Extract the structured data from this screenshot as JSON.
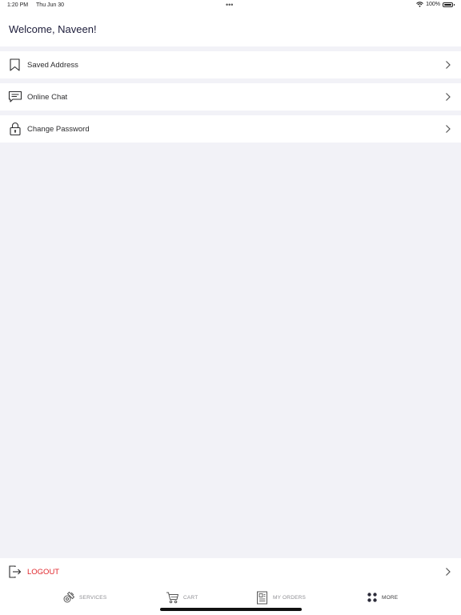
{
  "status": {
    "time": "1:20 PM",
    "date": "Thu Jun 30",
    "battery": "100%"
  },
  "header": {
    "title": "Welcome, Naveen!"
  },
  "menu": [
    {
      "label": "Saved Address",
      "icon": "bookmark-icon"
    },
    {
      "label": "Online Chat",
      "icon": "chat-icon"
    },
    {
      "label": "Change Password",
      "icon": "lock-icon"
    }
  ],
  "logout": {
    "label": "LOGOUT",
    "icon": "logout-icon",
    "color": "#e0262b"
  },
  "tabs": [
    {
      "label": "SERVICES",
      "icon": "services-icon"
    },
    {
      "label": "CART",
      "icon": "cart-icon"
    },
    {
      "label": "MY ORDERS",
      "icon": "orders-icon"
    },
    {
      "label": "MORE",
      "icon": "more-icon",
      "active": true
    }
  ]
}
